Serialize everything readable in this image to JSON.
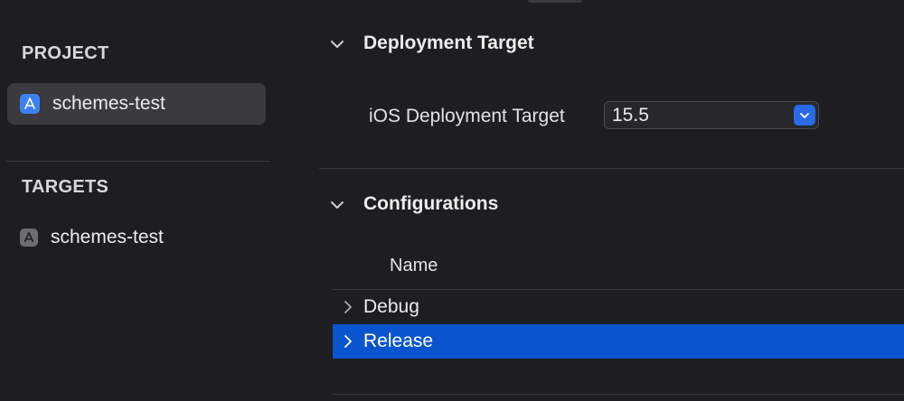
{
  "sidebar": {
    "project_header": "PROJECT",
    "project_item": {
      "label": "schemes-test",
      "icon": "xcode-project-icon"
    },
    "targets_header": "TARGETS",
    "target_item": {
      "label": "schemes-test",
      "icon": "app-target-icon"
    }
  },
  "deployment": {
    "section_title": "Deployment Target",
    "field_label": "iOS Deployment Target",
    "field_value": "15.5"
  },
  "configurations": {
    "section_title": "Configurations",
    "column_header": "Name",
    "rows": [
      {
        "label": "Debug",
        "selected": false
      },
      {
        "label": "Release",
        "selected": true
      }
    ]
  },
  "colors": {
    "background": "#1e1e22",
    "selection": "#0a55cf",
    "accent": "#2a6ae6"
  }
}
